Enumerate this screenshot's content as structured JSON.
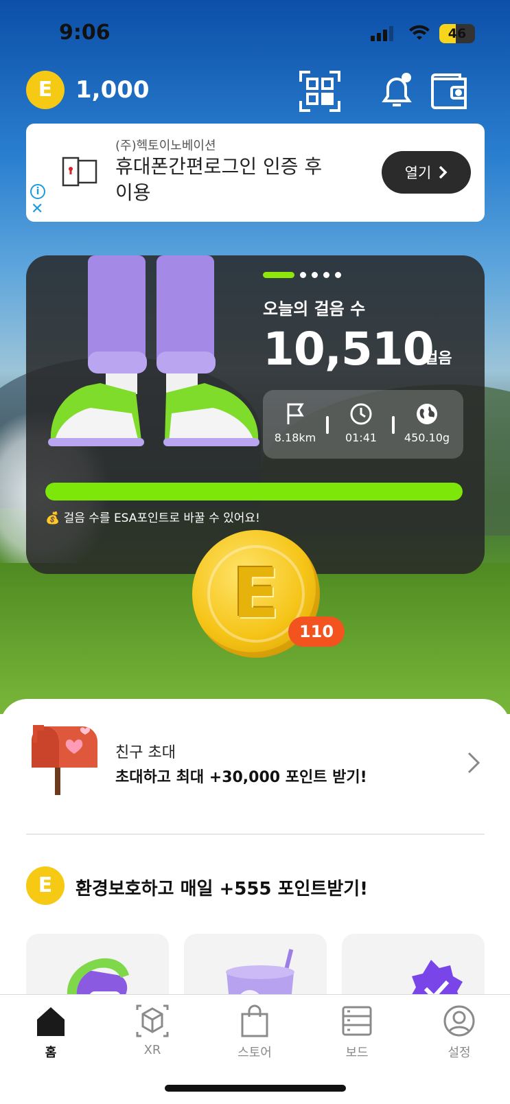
{
  "status_bar": {
    "time": "9:06",
    "battery": "46",
    "battery_level": 0.46
  },
  "header": {
    "point_badge": "E",
    "points": "1,000",
    "icons": [
      "qr-code-icon",
      "bell-icon",
      "wallet-icon"
    ]
  },
  "ad": {
    "company": "(주)헥토이노베이션",
    "headline": "휴대폰간편로그인 인증 후 이용",
    "cta": "열기",
    "info_glyph": "i",
    "close_glyph": "✕"
  },
  "steps": {
    "label": "오늘의 걸음 수",
    "count": "10,510",
    "unit": "걸음",
    "distance": "8.18km",
    "duration": "01:41",
    "co2": "450.10g",
    "progress": 1.0,
    "tip": "💰 걸음 수를 ESA포인트로 바꿀 수 있어요!",
    "page_dots_total": 5,
    "page_dots_active": 1
  },
  "reward_coin": {
    "letter": "E",
    "count": "110"
  },
  "invite": {
    "title": "친구 초대",
    "subtitle": "초대하고 최대 +30,000 포인트 받기!"
  },
  "eco": {
    "badge": "E",
    "title": "환경보호하고 매일 +555 포인트받기!"
  },
  "tabs": [
    {
      "label": "홈",
      "icon": "home-icon",
      "active": true
    },
    {
      "label": "XR",
      "icon": "xr-cube-icon",
      "active": false
    },
    {
      "label": "스토어",
      "icon": "shopping-bag-icon",
      "active": false
    },
    {
      "label": "보드",
      "icon": "board-icon",
      "active": false
    },
    {
      "label": "설정",
      "icon": "profile-icon",
      "active": false
    }
  ],
  "colors": {
    "accent_green": "#7ee70a",
    "coin_yellow": "#f6c915",
    "badge_orange": "#f2531f"
  }
}
